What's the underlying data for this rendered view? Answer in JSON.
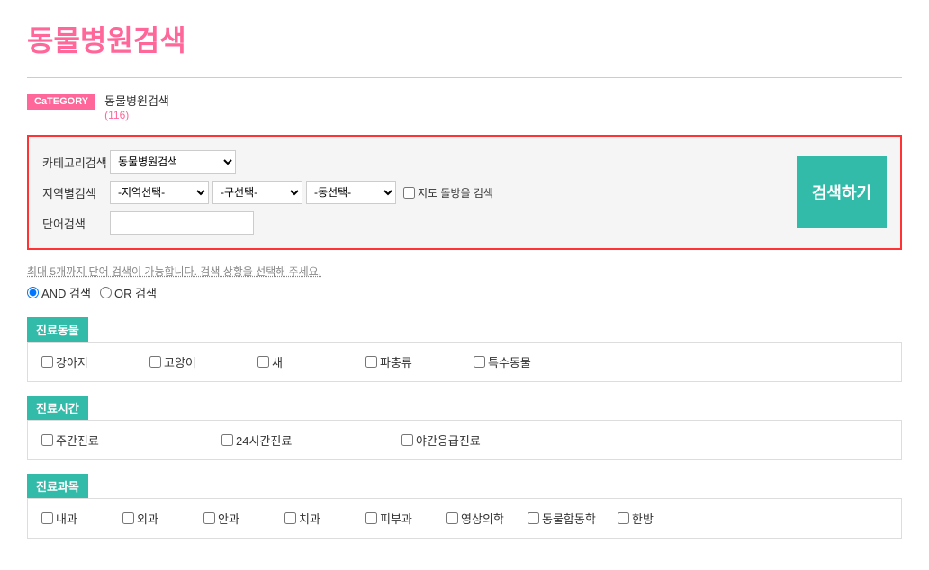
{
  "page": {
    "title": "동물병원검색"
  },
  "breadcrumb": {
    "badge": "CaTEGORY",
    "text": "동물병원검색",
    "count": "(116)"
  },
  "search": {
    "category_label": "카테고리검색",
    "region_label": "지역별검색",
    "keyword_label": "단어검색",
    "category_options": [
      "동물병원검색"
    ],
    "region_placeholder": "-지역선택-",
    "district_placeholder": "-구선택-",
    "dong_placeholder": "-동선택-",
    "map_check_label": "지도 돌방을 검색",
    "keyword_placeholder": "",
    "search_button": "검색하기"
  },
  "hint": {
    "text": "최대 5개까지 단어 검색이 가능합니다. 검색 상황을 선택해 주세요."
  },
  "radio": {
    "and_label": "AND 검색",
    "or_label": "OR 검색"
  },
  "filters": {
    "animal": {
      "title": "진료동물",
      "items": [
        "강아지",
        "고양이",
        "새",
        "파충류",
        "특수동물"
      ]
    },
    "time": {
      "title": "진료시간",
      "items": [
        "주간진료",
        "24시간진료",
        "야간응급진료"
      ]
    },
    "subject": {
      "title": "진료과목",
      "items": [
        "내과",
        "외과",
        "안과",
        "치과",
        "피부과",
        "영상의학",
        "동물합동학",
        "한방"
      ]
    }
  }
}
